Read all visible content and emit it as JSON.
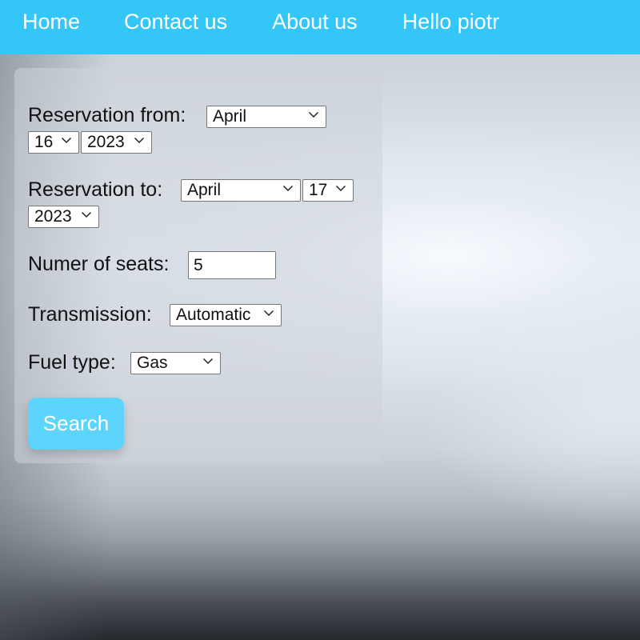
{
  "nav": {
    "home": "Home",
    "contact": "Contact us",
    "about": "About us",
    "greeting": "Hello piotr"
  },
  "form": {
    "reservation_from": {
      "label": "Reservation from:",
      "month": "April",
      "day": "16",
      "year": "2023"
    },
    "reservation_to": {
      "label": "Reservation to:",
      "month": "April",
      "day": "17",
      "year": "2023"
    },
    "seats": {
      "label": "Numer of seats:",
      "value": "5"
    },
    "transmission": {
      "label": "Transmission:",
      "value": "Automatic"
    },
    "fuel": {
      "label": "Fuel type:",
      "value": "Gas"
    },
    "search_label": "Search"
  },
  "colors": {
    "navbar": "#33c6f7",
    "button": "#5cd4fb",
    "nav_text": "#ffffff"
  },
  "icons": {
    "dropdown": "chevron-down-icon"
  }
}
